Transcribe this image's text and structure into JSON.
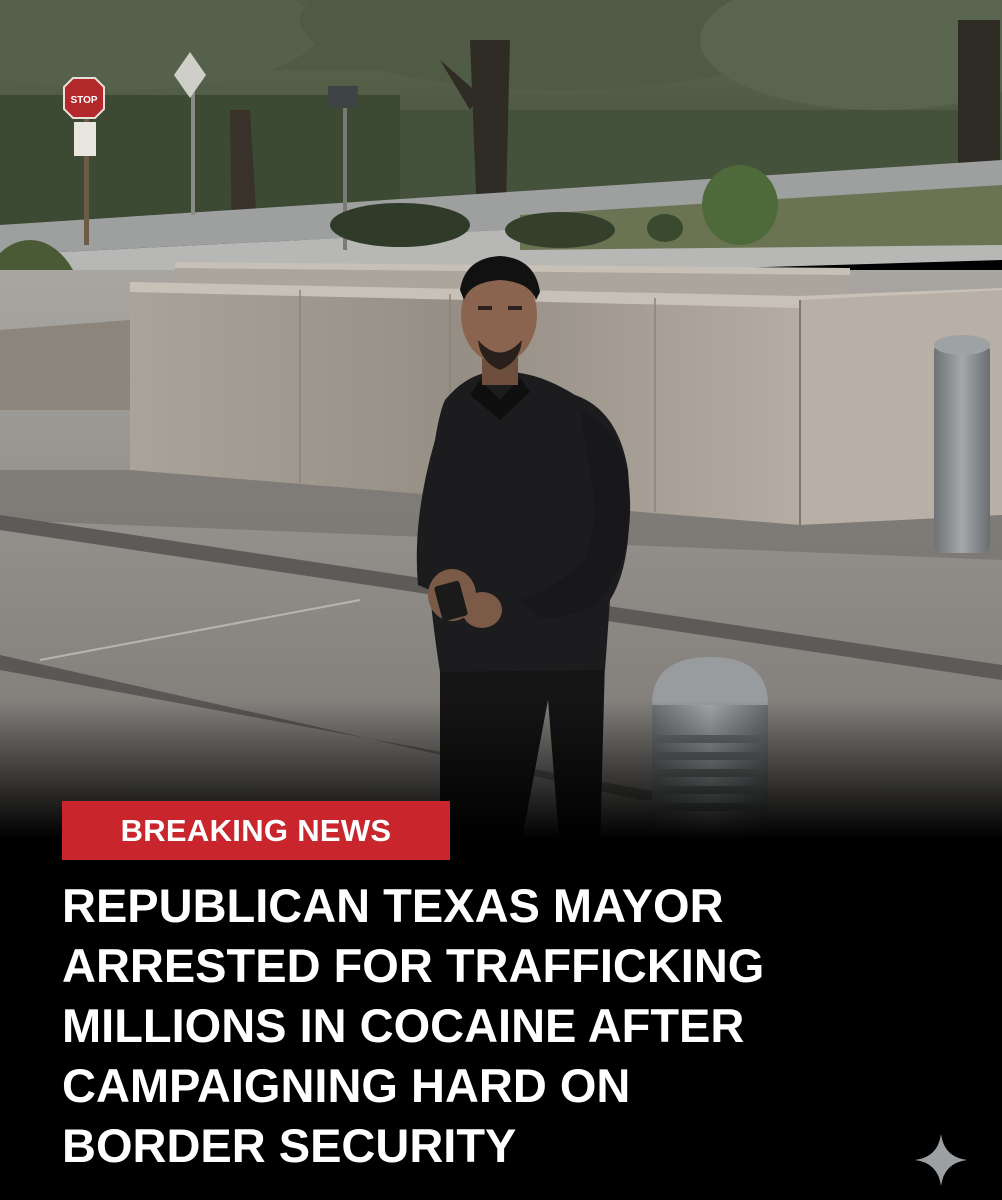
{
  "badge": {
    "label": "BREAKING NEWS",
    "color": "#c8262c"
  },
  "headline": {
    "lines": [
      "REPUBLICAN TEXAS MAYOR",
      "ARRESTED FOR TRAFFICKING",
      "MILLIONS IN COCAINE AFTER",
      "CAMPAIGNING HARD ON",
      "BORDER SECURITY"
    ]
  },
  "scene": {
    "stop_sign_text": "STOP"
  },
  "icons": {
    "corner": "sparkle-icon"
  }
}
